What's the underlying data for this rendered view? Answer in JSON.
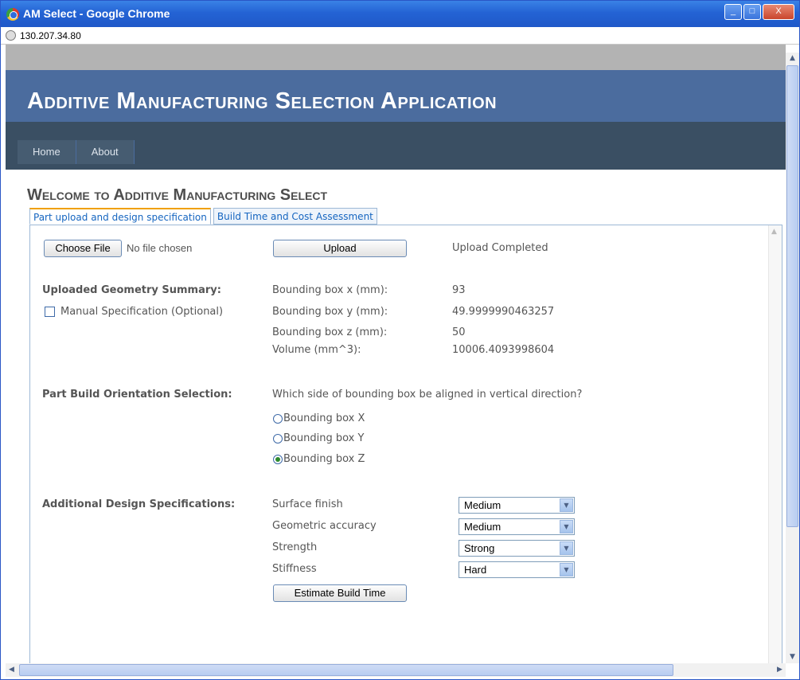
{
  "window": {
    "title": "AM Select - Google Chrome",
    "url": "130.207.34.80",
    "buttons": {
      "minimize": "_",
      "maximize": "□",
      "close": "X"
    }
  },
  "site": {
    "title": "Additive Manufacturing Selection Application",
    "nav": [
      "Home",
      "About"
    ],
    "welcome": "Welcome to Additive Manufacturing Select"
  },
  "tabs": [
    {
      "label": "Part upload and design specification",
      "active": true
    },
    {
      "label": "Build Time and Cost Assessment",
      "active": false
    }
  ],
  "upload": {
    "choose_file_label": "Choose File",
    "no_file_text": "No file chosen",
    "upload_button": "Upload",
    "status": "Upload Completed"
  },
  "geometry": {
    "heading": "Uploaded Geometry Summary:",
    "manual_spec_label": "Manual Specification (Optional)",
    "manual_spec_checked": false,
    "rows": [
      {
        "label": "Bounding box x (mm):",
        "value": "93"
      },
      {
        "label": "Bounding box y (mm):",
        "value": "49.9999990463257"
      },
      {
        "label": "Bounding box z (mm):",
        "value": "50"
      },
      {
        "label": "Volume (mm^3):",
        "value": "10006.4093998604"
      }
    ]
  },
  "orientation": {
    "heading": "Part Build Orientation Selection:",
    "question": "Which side of bounding box be aligned in vertical direction?",
    "options": [
      {
        "label": "Bounding box X",
        "checked": false
      },
      {
        "label": "Bounding box Y",
        "checked": false
      },
      {
        "label": "Bounding box Z",
        "checked": true
      }
    ]
  },
  "design": {
    "heading": "Additional Design Specifications:",
    "specs": [
      {
        "label": "Surface finish",
        "value": "Medium"
      },
      {
        "label": "Geometric accuracy",
        "value": "Medium"
      },
      {
        "label": "Strength",
        "value": "Strong"
      },
      {
        "label": "Stiffness",
        "value": "Hard"
      }
    ],
    "estimate_button": "Estimate Build Time"
  },
  "colors": {
    "header": "#4b6c9e",
    "nav": "#3a4f63",
    "tab_accent": "#f0a000"
  }
}
